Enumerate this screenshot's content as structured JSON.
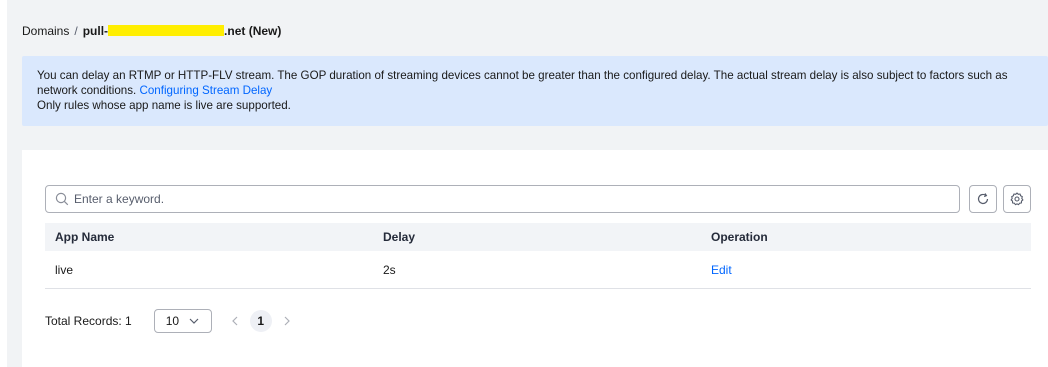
{
  "breadcrumb": {
    "root": "Domains",
    "separator": "/",
    "current_prefix": "pull-",
    "current_suffix": ".net (New)"
  },
  "notice": {
    "text": "You can delay an RTMP or HTTP-FLV stream. The GOP duration of streaming devices cannot be greater than the configured delay. The actual stream delay is also subject to factors such as network conditions.",
    "link": "Configuring Stream Delay",
    "note": "Only rules whose app name is live are supported."
  },
  "search": {
    "placeholder": "Enter a keyword.",
    "value": ""
  },
  "icons": {
    "search": "search-icon",
    "refresh": "refresh-icon",
    "settings": "gear-icon",
    "chevron": "chevron-down-icon"
  },
  "table": {
    "columns": [
      "App Name",
      "Delay",
      "Operation"
    ],
    "rows": [
      {
        "app_name": "live",
        "delay": "2s",
        "operation": "Edit"
      }
    ]
  },
  "pagination": {
    "total_label": "Total Records: 1",
    "page_size": "10",
    "current_page": "1"
  },
  "colors": {
    "accent": "#0066ff",
    "notice_bg": "#dae8fd",
    "page_bg": "#f1f3f5",
    "redaction": "#ffee00"
  }
}
